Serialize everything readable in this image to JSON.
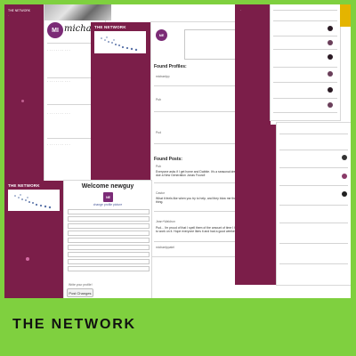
{
  "collage": {
    "label": "THE NETWORK",
    "colors": {
      "green": "#7fd03f",
      "maroon": "#7b1e49",
      "white": "#ffffff"
    }
  },
  "screen_profile": {
    "avatar_initials": "MI",
    "handle": "michaelppatel"
  },
  "screen_search": {
    "header_label": "THE NETWORK",
    "avatar_initials": "NE",
    "found_profiles": "Found Profiles:",
    "found_posts": "Found Posts:",
    "profiles": [
      {
        "name": "michaelpp",
        "initials": "M"
      },
      {
        "name": "Pub",
        "initials": ""
      },
      {
        "name": "Pud",
        "initials": "NE"
      }
    ],
    "posts": [
      {
        "user": "Pub",
        "text": "Everyone asks if I get home and Dabble. It's a seasonal dress doe a New Generation Jonas Found!"
      },
      {
        "user": "Castor",
        "text": "What it feels like when you try to help, and they blow me the thing."
      },
      {
        "user": "Jean+Waldrun",
        "text": "Pud... I'm proud of that I spell them of the amount of time I had to work on it. Hope everyone likes it and had a good weekend!"
      },
      {
        "user": "michaelppatel",
        "text": ""
      }
    ]
  },
  "screen_welcome": {
    "header_label": "THE NETWORK",
    "welcome_text": "Welcome newguy",
    "avatar_initials": "NE",
    "profile_link": "change profile picture",
    "save_button": "Post Changes",
    "bio_label": "Write your profile!"
  }
}
